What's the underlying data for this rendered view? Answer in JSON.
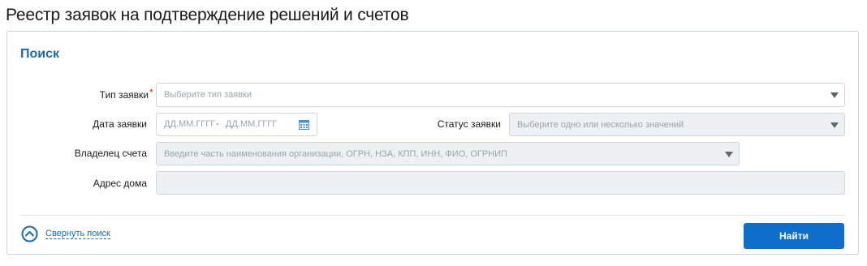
{
  "page": {
    "title": "Реестр заявок на подтверждение решений и счетов"
  },
  "search": {
    "title": "Поиск",
    "request_type": {
      "label": "Тип заявки",
      "required_mark": "*",
      "placeholder": "Выберите тип заявки"
    },
    "request_date": {
      "label": "Дата заявки",
      "from_placeholder": "ДД.ММ.ГГГГ",
      "separator": "-",
      "to_placeholder": "ДД.ММ.ГГГГ"
    },
    "request_status": {
      "label": "Статус заявки",
      "placeholder": "Выберите одно или несколько значений"
    },
    "account_owner": {
      "label": "Владелец счета",
      "placeholder": "Введите часть наименования организации, ОГРН, НЗА, КПП, ИНН, ФИО, ОГРНИП"
    },
    "house_address": {
      "label": "Адрес дома",
      "value": ""
    },
    "collapse_label": "Свернуть поиск",
    "find_button": "Найти"
  },
  "colors": {
    "accent": "#1c6aa8",
    "button": "#0d6fcb",
    "required": "#d9281f",
    "disabled_field": "#eef1f4"
  },
  "icons": {
    "dropdown": "chevron-down-icon",
    "calendar": "calendar-icon",
    "collapse": "chevron-up-circle-icon"
  }
}
